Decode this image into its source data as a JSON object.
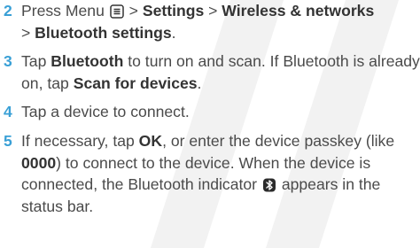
{
  "steps": [
    {
      "number": "2",
      "t1": "Press Menu",
      "t2": ">",
      "b1": "Settings",
      "t3": ">",
      "b2": "Wireless & networks",
      "t4": ">",
      "b3": "Bluetooth settings",
      "t5": "."
    },
    {
      "number": "3",
      "t1": "Tap",
      "b1": "Bluetooth",
      "t2": "to turn on and scan. If Bluetooth is already on, tap",
      "b2": "Scan for devices",
      "t3": "."
    },
    {
      "number": "4",
      "t1": "Tap a device to connect."
    },
    {
      "number": "5",
      "t1": "If necessary, tap",
      "b1": "OK",
      "t2": ", or enter the device passkey (like",
      "b2": "0000",
      "t3": ") to connect to the device. When the device is connected, the Bluetooth indicator",
      "t4": "appears in the status bar."
    }
  ],
  "icons": {
    "menu": "menu-key-icon",
    "bluetooth": "bluetooth-indicator-icon"
  },
  "colors": {
    "step_number": "#3aa0d6",
    "text": "#4a4a4a",
    "bold": "#333333"
  }
}
